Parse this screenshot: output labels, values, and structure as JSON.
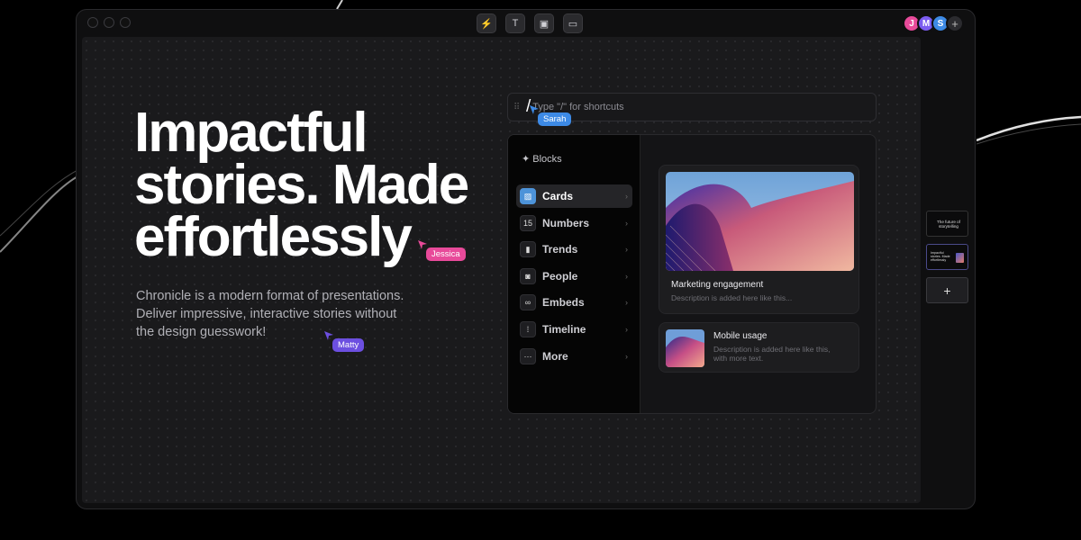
{
  "headline_lines": [
    "Impactful",
    "stories. Made",
    "effortlessly"
  ],
  "subtitle": "Chronicle is a modern format of presentations. Deliver impressive, interactive stories without the design guesswork!",
  "toolbar": {
    "icons": [
      "lightning-icon",
      "text-icon",
      "image-icon",
      "layout-icon"
    ],
    "glyphs": [
      "⚡",
      "T",
      "▣",
      "▭"
    ]
  },
  "collaborators": [
    {
      "initial": "J",
      "color": "#e84a9a"
    },
    {
      "initial": "M",
      "color": "#7b5cf0"
    },
    {
      "initial": "S",
      "color": "#3d8ae6"
    }
  ],
  "add_collaborator": "+",
  "cursors": [
    {
      "name": "Sarah",
      "color": "#3d8ae6"
    },
    {
      "name": "Jessica",
      "color": "#e84a9a"
    },
    {
      "name": "Matty",
      "color": "#6c4fe0"
    }
  ],
  "command_input": {
    "caret": "/",
    "placeholder": "Type \"/\" for shortcuts"
  },
  "blocks_menu": {
    "title": "✦ Blocks",
    "items": [
      {
        "label": "Cards",
        "glyph": "▨",
        "icon": "cards-icon",
        "active": true
      },
      {
        "label": "Numbers",
        "glyph": "15",
        "icon": "numbers-icon",
        "active": false
      },
      {
        "label": "Trends",
        "glyph": "▮",
        "icon": "trends-icon",
        "active": false
      },
      {
        "label": "People",
        "glyph": "◙",
        "icon": "people-icon",
        "active": false
      },
      {
        "label": "Embeds",
        "glyph": "∞",
        "icon": "embeds-icon",
        "active": false
      },
      {
        "label": "Timeline",
        "glyph": "⁞",
        "icon": "timeline-icon",
        "active": false
      },
      {
        "label": "More",
        "glyph": "···",
        "icon": "more-icon",
        "active": false
      }
    ],
    "chevron": "›"
  },
  "cards": [
    {
      "title": "Marketing engagement",
      "description": "Description is added here like this..."
    },
    {
      "title": "Mobile usage",
      "description": "Description is added here like this, with more text."
    }
  ],
  "slides": {
    "slide1_text": "The future of storytelling",
    "slide2_text": "Impactful stories. Made effortlessly",
    "add_label": "+"
  },
  "colors": {
    "accent_blue": "#4d93d9",
    "background": "#000000",
    "canvas": "#1a1a1c"
  }
}
